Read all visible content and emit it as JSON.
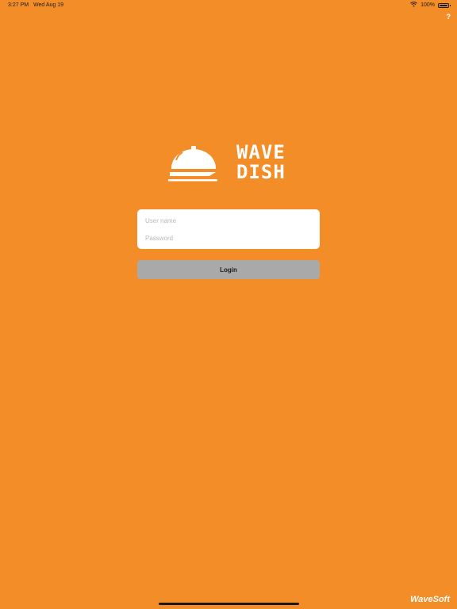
{
  "status_bar": {
    "time": "3:27 PM",
    "date": "Wed Aug 19",
    "battery": "100%"
  },
  "help": {
    "label": "?"
  },
  "logo": {
    "line1": "WAVE",
    "line2": "DISH",
    "icon": "cloche-icon"
  },
  "login": {
    "username_placeholder": "User name",
    "password_placeholder": "Password",
    "button_label": "Login"
  },
  "footer": {
    "brand": "WaveSoft"
  },
  "colors": {
    "background": "#f28d27",
    "button": "#a9a9a9",
    "card": "#ffffff"
  }
}
